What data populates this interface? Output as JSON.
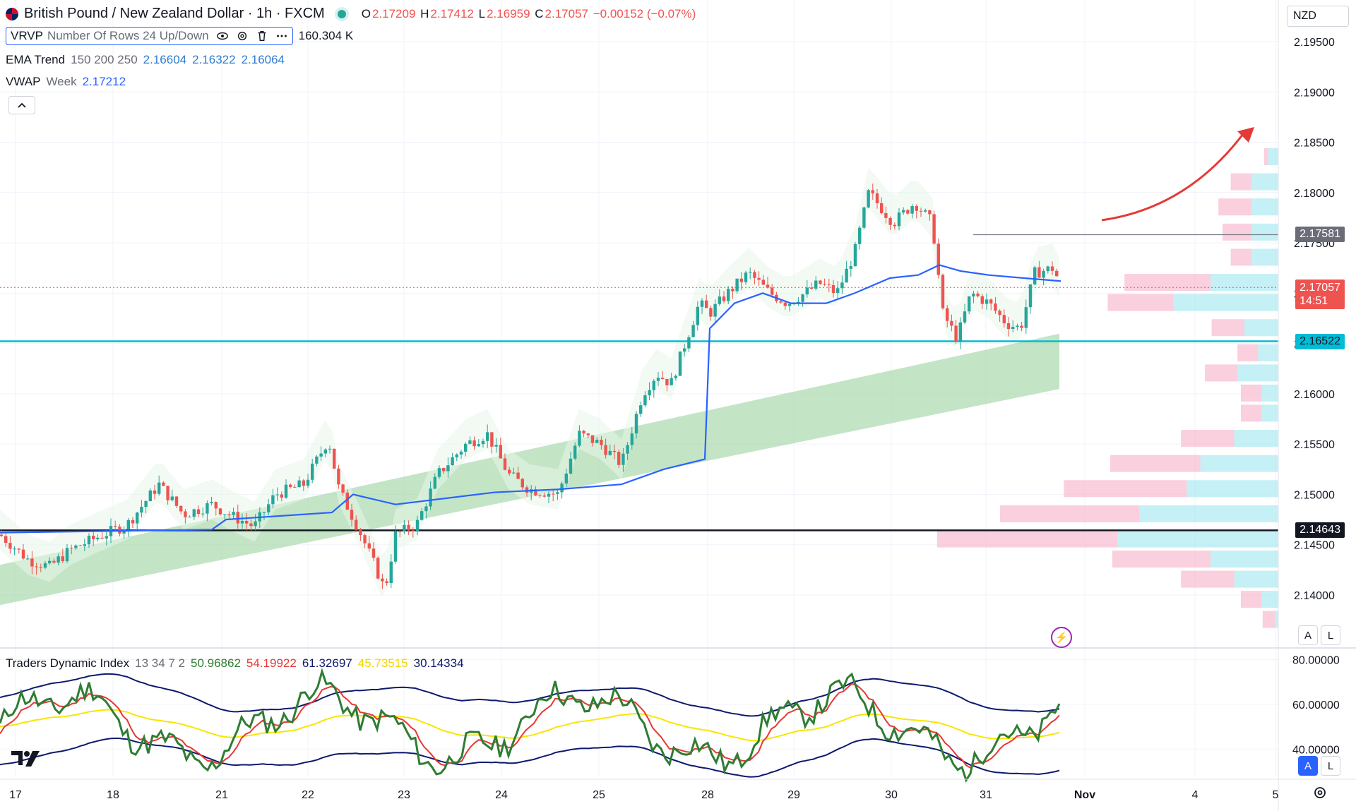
{
  "header": {
    "symbol_title": "British Pound / New Zealand Dollar · 1h · FXCM",
    "open_label": "O",
    "open": "2.17209",
    "high_label": "H",
    "high": "2.17412",
    "low_label": "L",
    "low": "2.16959",
    "close_label": "C",
    "close": "2.17057",
    "change": "−0.00152 (−0.07%)",
    "currency": "NZD"
  },
  "indicators": {
    "vrvp": {
      "name": "VRVP",
      "params": "Number Of Rows 24 Up/Down",
      "value": "160.304 K"
    },
    "ema": {
      "name": "EMA Trend",
      "params": "150 200 250",
      "v1": "2.16604",
      "v2": "2.16322",
      "v3": "2.16064"
    },
    "vwap": {
      "name": "VWAP",
      "params": "Week",
      "value": "2.17212"
    },
    "tdi": {
      "name": "Traders Dynamic Index",
      "params": "13 34 7 2",
      "v1": "50.96862",
      "v2": "54.19922",
      "v3": "61.32697",
      "v4": "45.73515",
      "v5": "30.14334"
    }
  },
  "price_tags": {
    "level_high": "2.17581",
    "last_price": "2.17057",
    "countdown": "14:51",
    "support": "2.16522",
    "level_low": "2.14643"
  },
  "axis_buttons": {
    "auto": "A",
    "log": "L",
    "auto2": "A",
    "log2": "L"
  },
  "collapse_icon": "chevron-up-icon",
  "colors": {
    "up": "#26a69a",
    "down": "#ef5350",
    "vwap": "#2962ff",
    "support": "#00bcd4",
    "resistance": "#131722",
    "arrow": "#e53935",
    "ema_band": "#a5d6a7",
    "tdi_green": "#2e7d32",
    "tdi_red": "#e53935",
    "tdi_yellow": "#f7e600",
    "tdi_bands": "#0d1a6e"
  },
  "chart_data": {
    "type": "candlestick",
    "y_axis_ticks": [
      "2.19500",
      "2.19000",
      "2.18500",
      "2.18000",
      "2.17500",
      "2.17000",
      "2.16500",
      "2.16000",
      "2.15500",
      "2.15000",
      "2.14500",
      "2.14000"
    ],
    "ylim": [
      2.1372,
      2.1964
    ],
    "x_axis_ticks": [
      "17",
      "18",
      "21",
      "22",
      "23",
      "24",
      "25",
      "28",
      "29",
      "30",
      "31",
      "Nov",
      "4",
      "5"
    ],
    "horizontal_levels": [
      2.17581,
      2.16522,
      2.14643
    ],
    "tdi_axis_ticks": [
      "80.00000",
      "60.00000",
      "40.00000"
    ],
    "tdi_ylim": [
      30,
      82
    ],
    "volume_profile_rows": [
      {
        "price": 2.1835,
        "up": 0.06,
        "down": 0.02
      },
      {
        "price": 2.181,
        "up": 0.16,
        "down": 0.1
      },
      {
        "price": 2.1785,
        "up": 0.16,
        "down": 0.16
      },
      {
        "price": 2.176,
        "up": 0.16,
        "down": 0.14
      },
      {
        "price": 2.1735,
        "up": 0.16,
        "down": 0.1
      },
      {
        "price": 2.171,
        "up": 0.4,
        "down": 0.42
      },
      {
        "price": 2.169,
        "up": 0.62,
        "down": 0.32
      },
      {
        "price": 2.1665,
        "up": 0.2,
        "down": 0.16
      },
      {
        "price": 2.164,
        "up": 0.12,
        "down": 0.1
      },
      {
        "price": 2.162,
        "up": 0.24,
        "down": 0.16
      },
      {
        "price": 2.16,
        "up": 0.1,
        "down": 0.1
      },
      {
        "price": 2.158,
        "up": 0.1,
        "down": 0.1
      },
      {
        "price": 2.1555,
        "up": 0.26,
        "down": 0.26
      },
      {
        "price": 2.153,
        "up": 0.46,
        "down": 0.44
      },
      {
        "price": 2.1505,
        "up": 0.54,
        "down": 0.6
      },
      {
        "price": 2.148,
        "up": 0.82,
        "down": 0.68
      },
      {
        "price": 2.1455,
        "up": 0.95,
        "down": 0.88
      },
      {
        "price": 2.1435,
        "up": 0.4,
        "down": 0.48
      },
      {
        "price": 2.1415,
        "up": 0.26,
        "down": 0.26
      },
      {
        "price": 2.1395,
        "up": 0.1,
        "down": 0.1
      },
      {
        "price": 2.1375,
        "up": 0.02,
        "down": 0.06
      }
    ]
  }
}
